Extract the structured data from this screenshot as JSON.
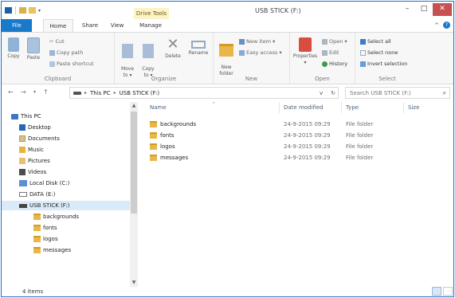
{
  "window": {
    "title": "USB STICK (F:)",
    "contextual_tab": "Drive Tools",
    "controls": {
      "minimize": "–",
      "maximize": "□",
      "close": "✕"
    },
    "accent": "#1979ca"
  },
  "tabs": [
    {
      "label": "File"
    },
    {
      "label": "Home"
    },
    {
      "label": "Share"
    },
    {
      "label": "View"
    },
    {
      "label": "Manage"
    }
  ],
  "ribbon": {
    "clipboard": {
      "label": "Clipboard",
      "copy": "Copy",
      "paste": "Paste",
      "cut": "Cut",
      "copy_path": "Copy path",
      "paste_shortcut": "Paste shortcut"
    },
    "organize": {
      "label": "Organize",
      "move_to": "Move\nto ▾",
      "copy_to": "Copy\nto ▾",
      "delete": "Delete",
      "rename": "Rename"
    },
    "new": {
      "label": "New",
      "new_folder": "New\nfolder",
      "new_item": "New item ▾",
      "easy_access": "Easy access ▾"
    },
    "open": {
      "label": "Open",
      "properties": "Properties",
      "open": "Open ▾",
      "edit": "Edit",
      "history": "History"
    },
    "select": {
      "label": "Select",
      "select_all": "Select all",
      "select_none": "Select none",
      "invert": "Invert selection"
    }
  },
  "address": {
    "back": "←",
    "forward": "→",
    "recent": "▾",
    "up": "↑",
    "crumbs": [
      "This PC",
      "USB STICK (F:)"
    ],
    "dropdown": "v",
    "refresh": "↻",
    "search_placeholder": "Search USB STICK (F:)"
  },
  "nav": {
    "items": [
      {
        "label": "This PC",
        "icon": "pc-icon"
      },
      {
        "label": "Desktop",
        "icon": "desktop-icon"
      },
      {
        "label": "Documents",
        "icon": "documents-icon"
      },
      {
        "label": "Music",
        "icon": "music-icon"
      },
      {
        "label": "Pictures",
        "icon": "pictures-icon"
      },
      {
        "label": "Videos",
        "icon": "videos-icon"
      },
      {
        "label": "Local Disk (C:)",
        "icon": "local-disk-icon"
      },
      {
        "label": "DATA (E:)",
        "icon": "drive-icon"
      },
      {
        "label": "USB STICK (F:)",
        "icon": "usb-drive-icon"
      },
      {
        "label": "backgrounds",
        "icon": "folder-icon"
      },
      {
        "label": "fonts",
        "icon": "folder-icon"
      },
      {
        "label": "logos",
        "icon": "folder-icon"
      },
      {
        "label": "messages",
        "icon": "folder-icon"
      }
    ]
  },
  "columns": {
    "name": "Name",
    "date": "Date modified",
    "type": "Type",
    "size": "Size"
  },
  "files": [
    {
      "name": "backgrounds",
      "date": "24-9-2015 09:29",
      "type": "File folder"
    },
    {
      "name": "fonts",
      "date": "24-9-2015 09:29",
      "type": "File folder"
    },
    {
      "name": "logos",
      "date": "24-9-2015 09:29",
      "type": "File folder"
    },
    {
      "name": "messages",
      "date": "24-9-2015 09:29",
      "type": "File folder"
    }
  ],
  "status": {
    "count": "4 items"
  }
}
